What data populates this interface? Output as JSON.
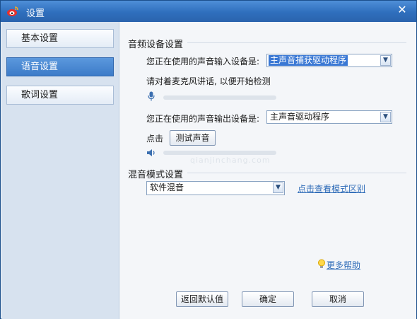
{
  "window": {
    "title": "设置",
    "close_glyph": "✕"
  },
  "sidebar": {
    "items": [
      {
        "label": "基本设置"
      },
      {
        "label": "语音设置"
      },
      {
        "label": "歌词设置"
      }
    ]
  },
  "audio_device": {
    "section_title": "音频设备设置",
    "input_label": "您正在使用的声音输入设备是:",
    "input_value": "主声音捕获驱动程序",
    "mic_hint": "请对着麦克风讲话, 以便开始检测",
    "output_label": "您正在使用的声音输出设备是:",
    "output_value": "主声音驱动程序",
    "click_label": "点击",
    "test_sound_label": "测试声音",
    "input_level": 0,
    "output_level": 0
  },
  "watermark": "qianjinchang.com",
  "mix_mode": {
    "section_title": "混音模式设置",
    "value": "软件混音",
    "view_modes_link": "点击查看模式区别"
  },
  "footer": {
    "more_help": "更多帮助",
    "restore_defaults": "返回默认值",
    "ok": "确定",
    "cancel": "取消"
  }
}
